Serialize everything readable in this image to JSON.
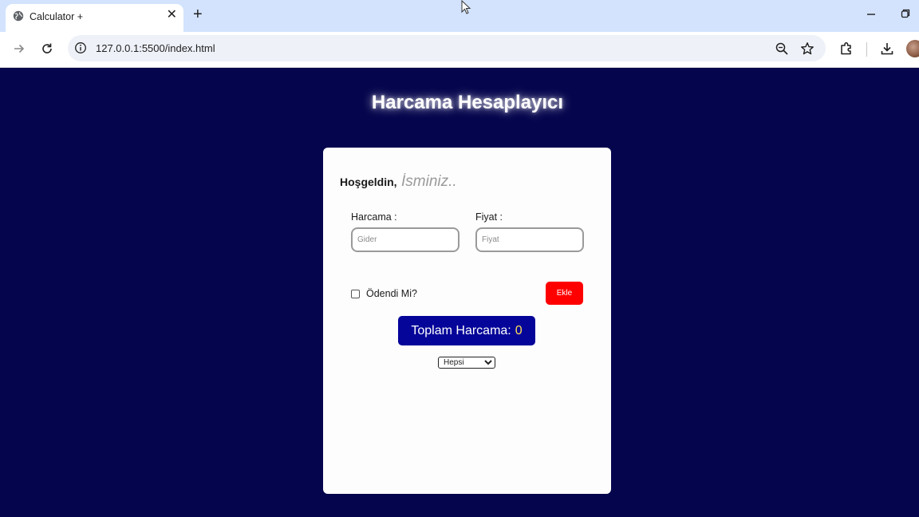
{
  "browser": {
    "tab_title": "Calculator +",
    "url": "127.0.0.1:5500/index.html"
  },
  "page": {
    "title": "Harcama Hesaplayıcı",
    "welcome_label": "Hoşgeldin,",
    "name_placeholder": "İsminiz..",
    "expense_label": "Harcama :",
    "expense_placeholder": "Gider",
    "price_label": "Fiyat :",
    "price_placeholder": "Fiyat",
    "paid_label": "Ödendi Mi?",
    "add_button": "Ekle",
    "total_label": "Toplam Harcama:",
    "total_value": "0",
    "filter_selected": "Hepsi"
  },
  "colors": {
    "page_background": "#05054d",
    "add_button": "#ff0000",
    "total_box": "#05059a",
    "total_value": "#ffdf5a"
  }
}
